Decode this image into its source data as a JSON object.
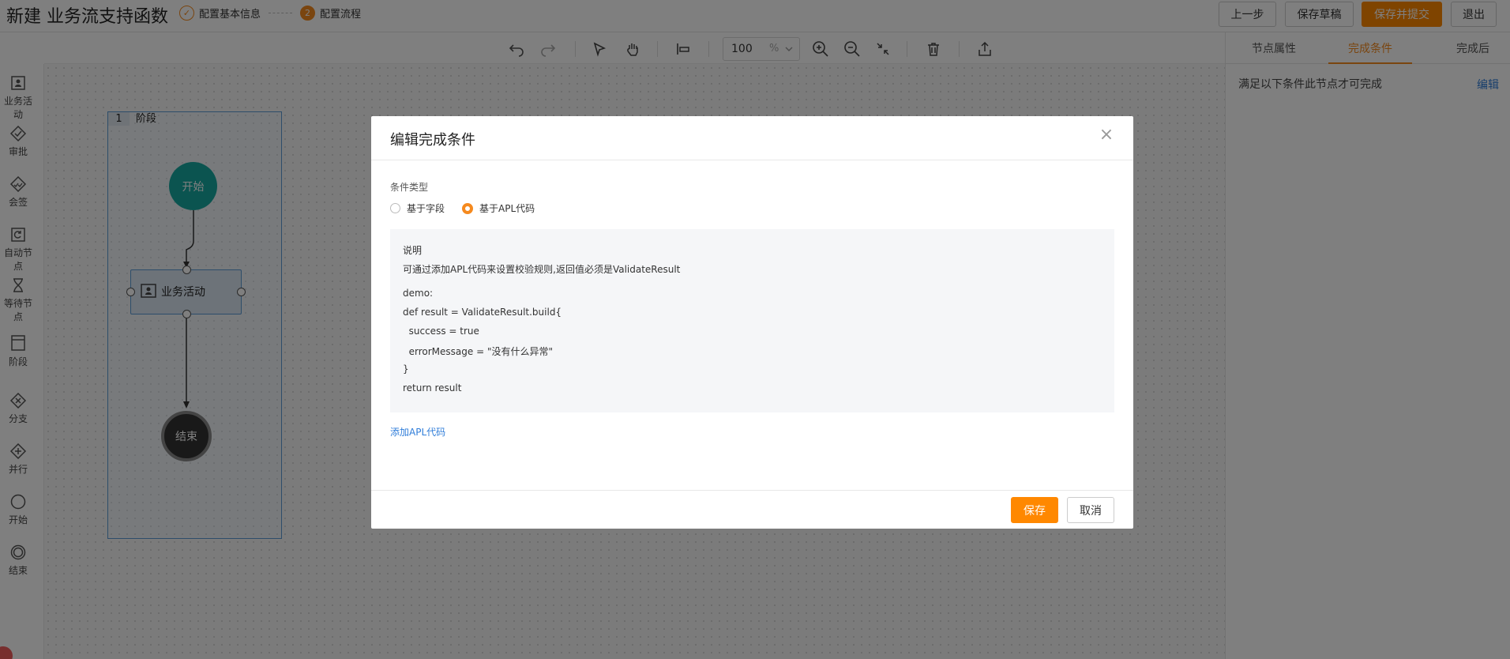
{
  "header": {
    "title": "新建 业务流支持函数",
    "steps": [
      {
        "label": "配置基本信息",
        "icon": "check-circle-icon"
      },
      {
        "label": "配置流程",
        "number": "2"
      }
    ],
    "buttons": {
      "prev": "上一步",
      "save_draft": "保存草稿",
      "save_submit": "保存并提交",
      "exit": "退出"
    }
  },
  "palette": {
    "items": [
      {
        "label": "业务活动",
        "icon": "business-activity-icon"
      },
      {
        "label": "审批",
        "icon": "approval-icon"
      },
      {
        "label": "会签",
        "icon": "countersign-icon"
      },
      {
        "label": "自动节点",
        "icon": "auto-node-icon"
      },
      {
        "label": "等待节点",
        "icon": "hourglass-icon"
      },
      {
        "label": "阶段",
        "icon": "stage-icon"
      },
      {
        "label": "分支",
        "icon": "branch-icon"
      },
      {
        "label": "并行",
        "icon": "parallel-icon"
      },
      {
        "label": "开始",
        "icon": "start-icon"
      },
      {
        "label": "结束",
        "icon": "end-icon"
      }
    ]
  },
  "toolbar": {
    "zoom_value": "100",
    "zoom_unit": "%"
  },
  "canvas": {
    "stage": {
      "number": "1",
      "name": "阶段"
    },
    "start_label": "开始",
    "task_label": "业务活动",
    "end_label": "结束"
  },
  "right_panel": {
    "tabs": [
      "节点属性",
      "完成条件",
      "完成后"
    ],
    "active_tab": "完成条件",
    "condition_text": "满足以下条件此节点才可完成",
    "edit_link": "编辑"
  },
  "modal": {
    "title": "编辑完成条件",
    "condition_type_label": "条件类型",
    "radio_options": [
      "基于字段",
      "基于APL代码"
    ],
    "selected_option": "基于APL代码",
    "code_lines": [
      "说明",
      "可通过添加APL代码来设置校验规则,返回值必须是ValidateResult",
      "demo:",
      "def result = ValidateResult.build{",
      "  success = true",
      "  errorMessage = \"没有什么异常\"",
      "}",
      "return result"
    ],
    "add_code_link": "添加APL代码",
    "save_button": "保存",
    "cancel_button": "取消"
  },
  "colors": {
    "accent": "#ff8800",
    "link": "#2f7dd9",
    "start_node": "#17a8a0",
    "stage_border": "#5b9bd5"
  }
}
